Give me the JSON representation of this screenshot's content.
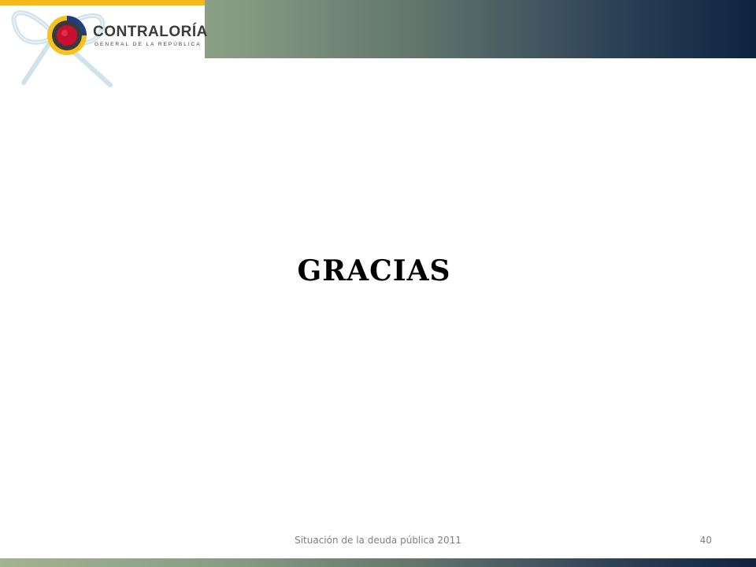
{
  "header": {
    "logo": {
      "brand_name": "CONTRALORÍA",
      "brand_subtitle": "GENERAL DE LA REPÚBLICA",
      "icon": "contraloria-seal-icon",
      "ribbon_icon": "ribbon-icon"
    },
    "colors": {
      "gold": "#f7b81c",
      "band_start": "#a3b391",
      "band_end": "#0f2340",
      "seal_red": "#c8102e",
      "seal_blue": "#1f3c88"
    }
  },
  "slide": {
    "title": "GRACIAS"
  },
  "footer": {
    "text": "Situación de la deuda pública 2011",
    "page_number": "40"
  }
}
